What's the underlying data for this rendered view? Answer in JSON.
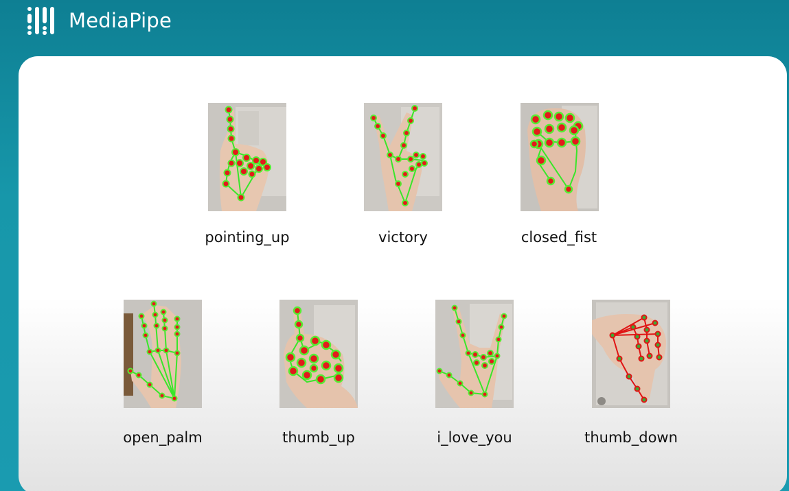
{
  "header": {
    "brand_name": "MediaPipe",
    "logo_icon": "mediapipe-logo-icon"
  },
  "colors": {
    "header_bg": "#0e7f93",
    "landmark_point": "#e21b1b",
    "landmark_outline": "#55ee33",
    "connection_line": "#39e62a",
    "thumb_down_line": "#e01414"
  },
  "gestures": [
    {
      "label": "pointing_up"
    },
    {
      "label": "victory"
    },
    {
      "label": "closed_fist"
    },
    {
      "label": "open_palm"
    },
    {
      "label": "thumb_up"
    },
    {
      "label": "i_love_you"
    },
    {
      "label": "thumb_down"
    }
  ]
}
